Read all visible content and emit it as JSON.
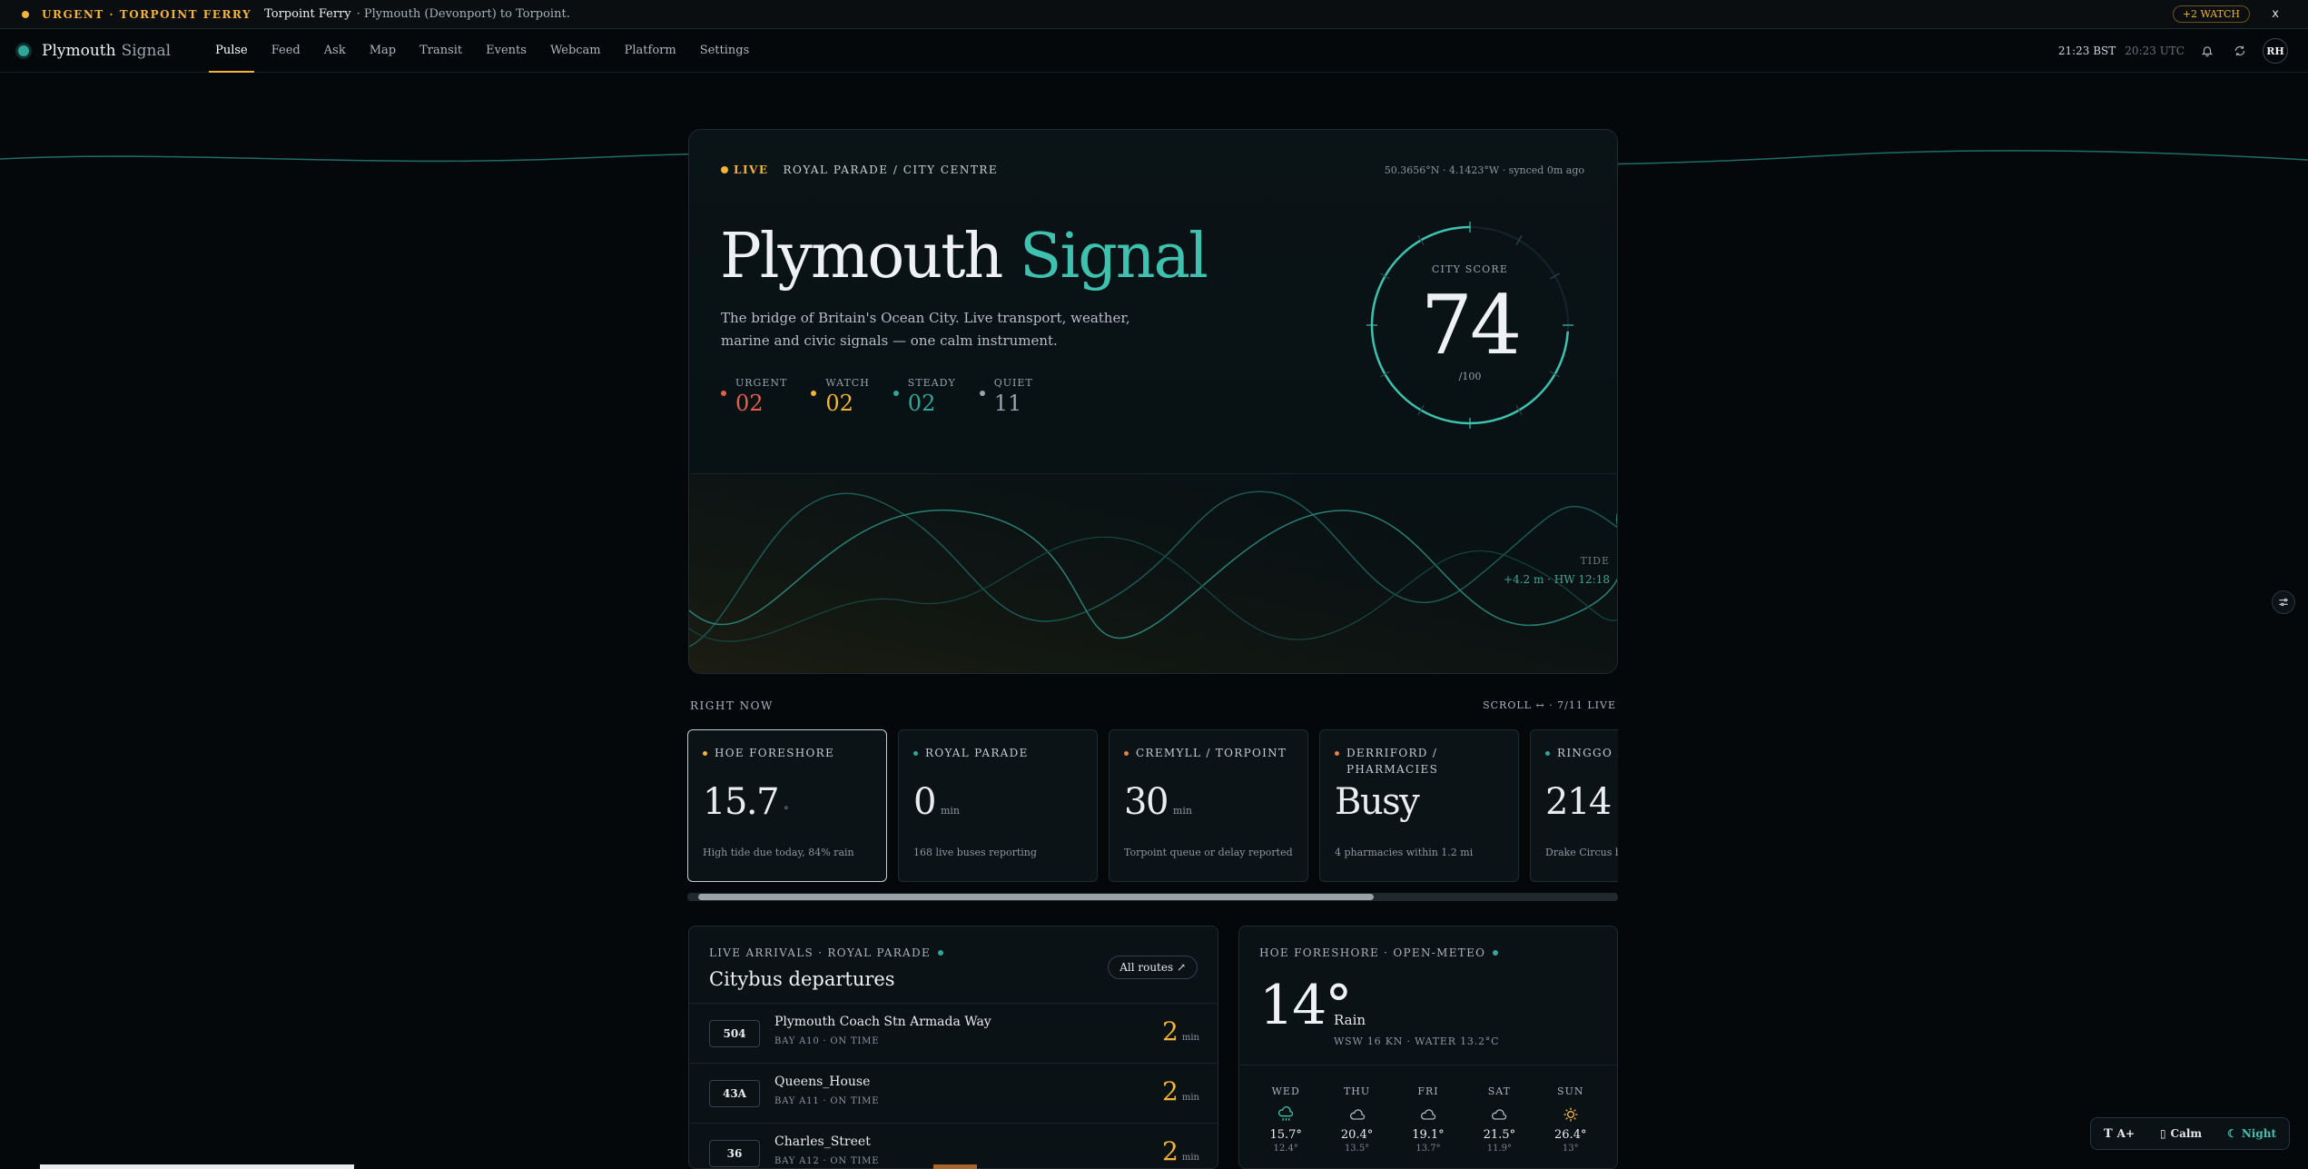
{
  "banner": {
    "tag": "URGENT · TORPOINT FERRY",
    "route": "Torpoint Ferry",
    "desc": "· Plymouth (Devonport) to Torpoint.",
    "watch": "+2 WATCH",
    "close": "x"
  },
  "nav": {
    "brand_main": "Plymouth",
    "brand_sub": "Signal",
    "tabs": [
      "Pulse",
      "Feed",
      "Ask",
      "Map",
      "Transit",
      "Events",
      "Webcam",
      "Platform",
      "Settings"
    ],
    "active_tab": "Pulse",
    "clock_local": "21:23 BST",
    "clock_utc": "20:23 UTC",
    "avatar": "RH"
  },
  "hero": {
    "live": "LIVE",
    "location": "ROYAL PARADE / CITY CENTRE",
    "coords": "50.3656°N · 4.1423°W · synced 0m ago",
    "title_a": "Plymouth",
    "title_b": "Signal",
    "subtitle": "The bridge of Britain's Ocean City. Live transport, weather, marine and civic signals — one calm instrument.",
    "stats": [
      {
        "label": "URGENT",
        "value": "02",
        "color": "#e4604a"
      },
      {
        "label": "WATCH",
        "value": "02",
        "color": "#f2b43a"
      },
      {
        "label": "STEADY",
        "value": "02",
        "color": "#2fa69a"
      },
      {
        "label": "QUIET",
        "value": "11",
        "color": "#9aa4aa"
      }
    ],
    "score_label": "CITY SCORE",
    "score": "74",
    "score_max": "/100",
    "score_value": 74,
    "tide_label": "TIDE",
    "tide_value": "+4.2 m · HW 12:18"
  },
  "right_now": {
    "heading": "RIGHT NOW",
    "scroll": "SCROLL ↔ · 7/11 LIVE",
    "cards": [
      {
        "title": "HOE FORESHORE",
        "value": "15.7",
        "unit": "°",
        "note": "High tide due today, 84% rain",
        "dot": "#f2b43a"
      },
      {
        "title": "ROYAL PARADE",
        "value": "0",
        "unit": "min",
        "note": "168 live buses reporting",
        "dot": "#2fa69a"
      },
      {
        "title": "CREMYLL / TORPOINT",
        "value": "30",
        "unit": "min",
        "note": "Torpoint queue or delay reported",
        "dot": "#e4804a"
      },
      {
        "title": "DERRIFORD / PHARMACIES",
        "value": "Busy",
        "unit": "",
        "note": "4 pharmacies within 1.2 mi",
        "dot": "#e4804a"
      },
      {
        "title": "RINGGO ZONES",
        "value": "214",
        "unit": "",
        "note": "Drake Circus busiest",
        "dot": "#2fa69a"
      }
    ]
  },
  "departures": {
    "heading": "LIVE ARRIVALS · ROYAL PARADE",
    "title": "Citybus departures",
    "all_routes": "All routes ↗",
    "rows": [
      {
        "route": "504",
        "dest": "Plymouth Coach Stn Armada Way",
        "meta": "BAY A10 · ON TIME",
        "eta": "2",
        "unit": "min"
      },
      {
        "route": "43A",
        "dest": "Queens_House",
        "meta": "BAY A11 · ON TIME",
        "eta": "2",
        "unit": "min"
      },
      {
        "route": "36",
        "dest": "Charles_Street",
        "meta": "BAY A12 · ON TIME",
        "eta": "2",
        "unit": "min"
      }
    ]
  },
  "weather": {
    "heading": "HOE FORESHORE · OPEN-METEO",
    "temp": "14°",
    "condition": "Rain",
    "detail": "WSW 16 KN · WATER 13.2°C",
    "days": [
      {
        "name": "WED",
        "icon": "rain-cloud-icon",
        "high": "15.7°",
        "low": "12.4°"
      },
      {
        "name": "THU",
        "icon": "cloud-icon",
        "high": "20.4°",
        "low": "13.5°"
      },
      {
        "name": "FRI",
        "icon": "cloud-icon",
        "high": "19.1°",
        "low": "13.7°"
      },
      {
        "name": "SAT",
        "icon": "cloud-icon",
        "high": "21.5°",
        "low": "11.9°"
      },
      {
        "name": "SUN",
        "icon": "sun-icon",
        "high": "26.4°",
        "low": "13°"
      }
    ]
  },
  "toolbar": {
    "text_size": "A+",
    "calm": "Calm",
    "night": "Night"
  },
  "colors": {
    "accent": "#3fc1b0",
    "warning": "#f2b43a",
    "urgent": "#e4604a"
  }
}
